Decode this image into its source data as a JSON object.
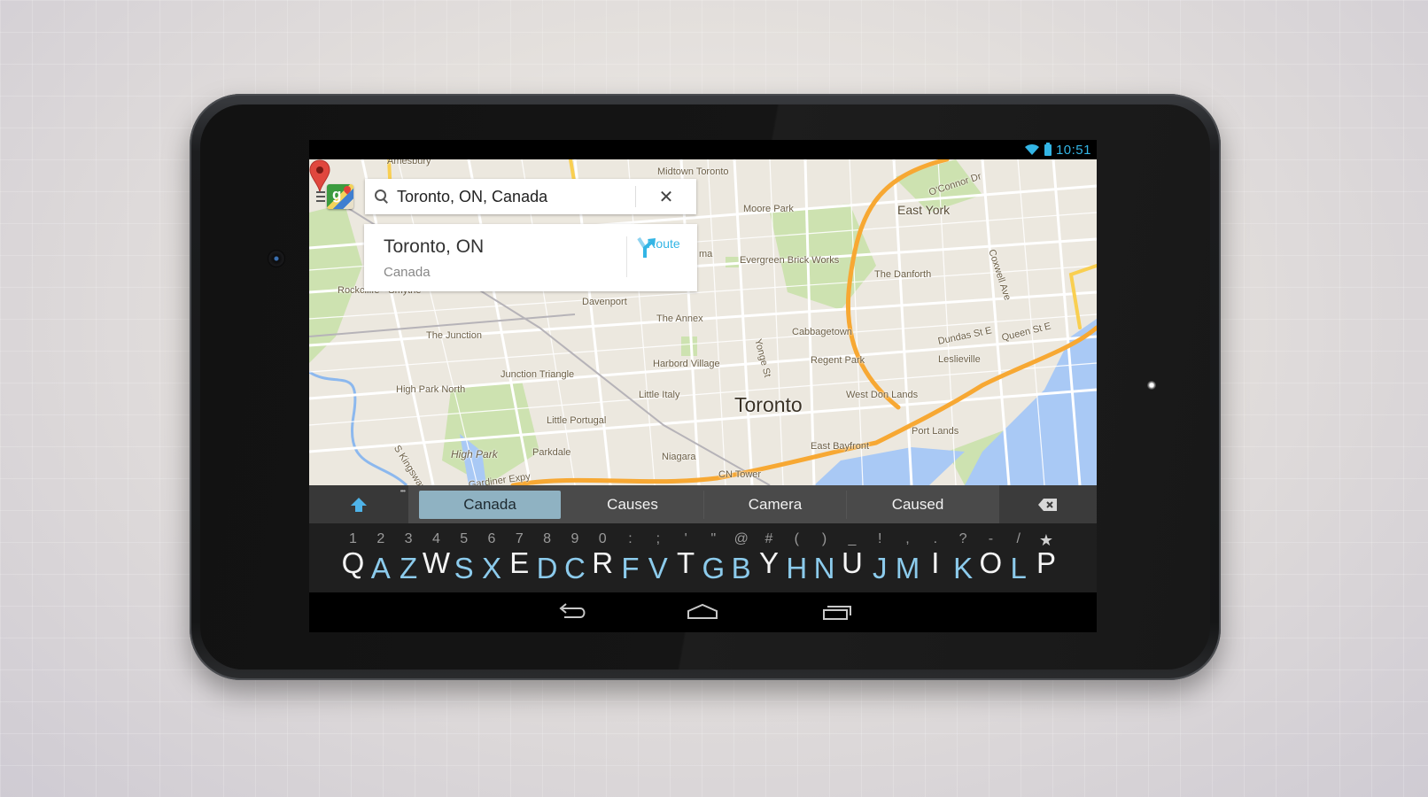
{
  "status_bar": {
    "time": "10:51",
    "icons": [
      "wifi-icon",
      "battery-icon"
    ],
    "accent_color": "#33b5e5"
  },
  "map": {
    "app_logo": "google-maps-logo",
    "menu_icon": "menu-icon",
    "search": {
      "value": "Toronto, ON, Canada",
      "clear_icon": "✕"
    },
    "result": {
      "title": "Toronto, ON",
      "subtitle": "Canada",
      "route_label": "Route"
    },
    "labels": [
      {
        "text": "Amesbury"
      },
      {
        "text": "Midtown Toronto"
      },
      {
        "text": "O'Connor Dr"
      },
      {
        "text": "Moore Park"
      },
      {
        "text": "East York"
      },
      {
        "text": "Evergreen Brick Works"
      },
      {
        "text": "The Danforth"
      },
      {
        "text": "Coxwell Ave"
      },
      {
        "text": "Rockcliffe - Smythe"
      },
      {
        "text": "Davenport"
      },
      {
        "text": "The Annex"
      },
      {
        "text": "Cabbagetown"
      },
      {
        "text": "The Junction"
      },
      {
        "text": "Yonge St"
      },
      {
        "text": "Regent Park"
      },
      {
        "text": "Dundas St E"
      },
      {
        "text": "Queen St E"
      },
      {
        "text": "Leslieville"
      },
      {
        "text": "Harbord Village"
      },
      {
        "text": "Junction Triangle"
      },
      {
        "text": "High Park North"
      },
      {
        "text": "Little Italy"
      },
      {
        "text": "Toronto"
      },
      {
        "text": "West Don Lands"
      },
      {
        "text": "Little Portugal"
      },
      {
        "text": "Port Lands"
      },
      {
        "text": "S Kingsway"
      },
      {
        "text": "High Park"
      },
      {
        "text": "Parkdale"
      },
      {
        "text": "Niagara"
      },
      {
        "text": "East Bayfront"
      },
      {
        "text": "CN Tower"
      },
      {
        "text": "Gardiner Expy"
      },
      {
        "text": "ma"
      }
    ]
  },
  "keyboard": {
    "suggestions": [
      {
        "label": "Canada",
        "active": true
      },
      {
        "label": "Causes",
        "active": false
      },
      {
        "label": "Camera",
        "active": false
      },
      {
        "label": "Caused",
        "active": false
      }
    ],
    "keys": [
      {
        "sym": "1",
        "main": "Q",
        "style": "white"
      },
      {
        "sym": "2",
        "main": "A",
        "style": "blue"
      },
      {
        "sym": "3",
        "main": "Z",
        "style": "blue"
      },
      {
        "sym": "4",
        "main": "W",
        "style": "white"
      },
      {
        "sym": "5",
        "main": "S",
        "style": "blue"
      },
      {
        "sym": "6",
        "main": "X",
        "style": "blue"
      },
      {
        "sym": "7",
        "main": "E",
        "style": "white"
      },
      {
        "sym": "8",
        "main": "D",
        "style": "blue"
      },
      {
        "sym": "9",
        "main": "C",
        "style": "blue"
      },
      {
        "sym": "0",
        "main": "R",
        "style": "white"
      },
      {
        "sym": ":",
        "main": "F",
        "style": "blue"
      },
      {
        "sym": ";",
        "main": "V",
        "style": "blue"
      },
      {
        "sym": "'",
        "main": "T",
        "style": "white"
      },
      {
        "sym": "\"",
        "main": "G",
        "style": "blue"
      },
      {
        "sym": "@",
        "main": "B",
        "style": "blue"
      },
      {
        "sym": "#",
        "main": "Y",
        "style": "white"
      },
      {
        "sym": "(",
        "main": "H",
        "style": "blue"
      },
      {
        "sym": ")",
        "main": "N",
        "style": "blue"
      },
      {
        "sym": "_",
        "main": "U",
        "style": "white"
      },
      {
        "sym": "!",
        "main": "J",
        "style": "blue"
      },
      {
        "sym": ",",
        "main": "M",
        "style": "blue"
      },
      {
        "sym": ".",
        "main": "I",
        "style": "white"
      },
      {
        "sym": "?",
        "main": "K",
        "style": "blue"
      },
      {
        "sym": "-",
        "main": "O",
        "style": "white"
      },
      {
        "sym": "/",
        "main": "L",
        "style": "blue"
      },
      {
        "sym": "★",
        "main": "P",
        "style": "white"
      }
    ]
  },
  "navigation": {
    "buttons": [
      "back-icon",
      "home-icon",
      "recent-apps-icon"
    ]
  }
}
